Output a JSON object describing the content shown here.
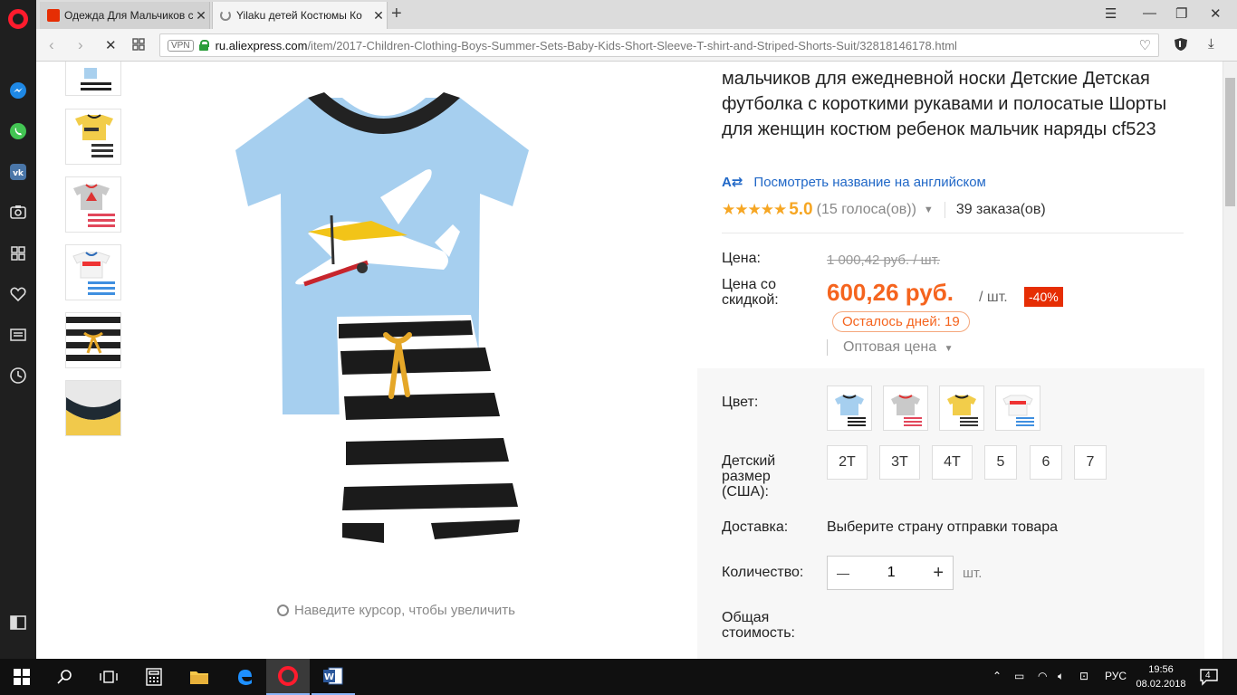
{
  "browser": {
    "tabs": [
      {
        "label": "Одежда Для Мальчиков с",
        "active": false
      },
      {
        "label": "Yilaku детей Костюмы Ко",
        "active": true
      }
    ],
    "url_host": "ru.aliexpress.com",
    "url_path": "/item/2017-Children-Clothing-Boys-Summer-Sets-Baby-Kids-Short-Sleeve-T-shirt-and-Striped-Shorts-Suit/32818146178.html",
    "vpn_label": "VPN"
  },
  "sidebar_icons": [
    "opera-icon",
    "messenger-icon",
    "whatsapp-icon",
    "vk-icon",
    "camera-icon",
    "speed-dial-icon",
    "heart-icon",
    "news-icon",
    "history-icon",
    "sidebar-toggle-icon"
  ],
  "gallery": {
    "zoom_hint": "Наведите курсор, чтобы увеличить"
  },
  "product": {
    "title": "мальчиков для ежедневной носки Детские Детская футболка с короткими рукавами и полосатые Шорты для женщин костюм ребенок мальчик наряды cf523",
    "translate_icon": "А⇄",
    "translate_link": "Посмотреть название на английском",
    "stars": "★★★★★",
    "rating": "5.0",
    "votes": "(15 голоса(ов))",
    "orders": "39 заказа(ов)",
    "price_label": "Цена:",
    "old_price": "1 000,42 руб. / шт.",
    "discount_price_label": "Цена со скидкой:",
    "new_price": "600,26 руб.",
    "per_unit": "/ шт.",
    "discount": "-40%",
    "days_left": "Осталось дней: 19",
    "wholesale": "Оптовая цена",
    "color_label": "Цвет:",
    "size_label": "Детский размер (США):",
    "sizes": [
      "2T",
      "3T",
      "4T",
      "5",
      "6",
      "7"
    ],
    "shipping_label": "Доставка:",
    "shipping_value": "Выберите страну отправки товара",
    "qty_label": "Количество:",
    "qty_value": "1",
    "qty_minus": "—",
    "qty_plus": "+",
    "qty_unit": "шт.",
    "total_label": "Общая стоимость:"
  },
  "taskbar": {
    "lang": "РУС",
    "time": "19:56",
    "date": "08.02.2018",
    "notifications": "4",
    "word_label": "W"
  }
}
